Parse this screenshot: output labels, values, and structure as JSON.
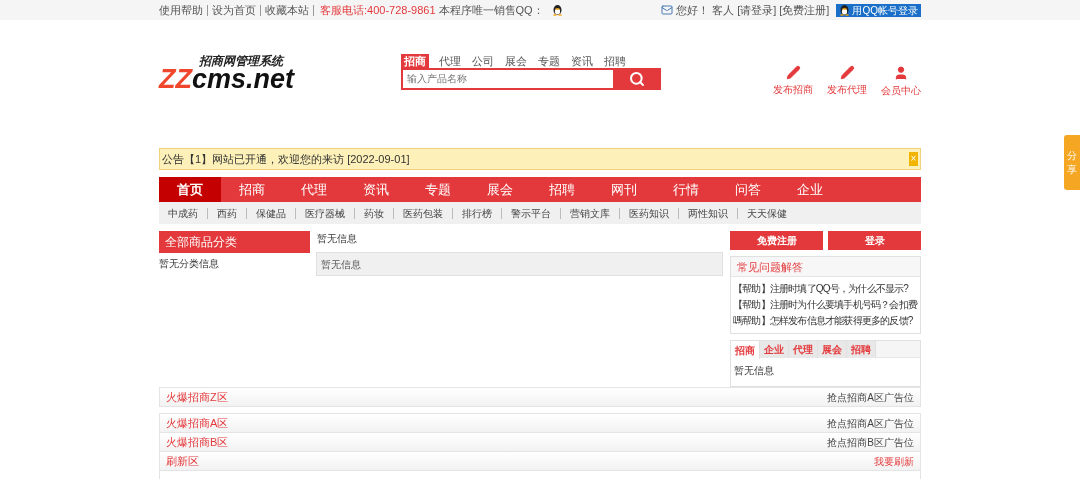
{
  "top_bar": {
    "links": [
      "使用帮助",
      "设为首页",
      "收藏本站"
    ],
    "hotline": "客服电话:400-728-9861",
    "qq_label": "本程序唯一销售QQ：",
    "greeting": "您好！",
    "user": "客人",
    "login": "[请登录]",
    "register": "[免费注册]",
    "qq_login": "用QQ帐号登录"
  },
  "header": {
    "logo_subtitle": "招商网管理系统",
    "logo_accent": "ZZ",
    "logo_rest": "cms.net",
    "search_tabs": [
      {
        "label": "招商",
        "selected": true
      },
      {
        "label": "代理",
        "selected": false
      },
      {
        "label": "公司",
        "selected": false
      },
      {
        "label": "展会",
        "selected": false
      },
      {
        "label": "专题",
        "selected": false
      },
      {
        "label": "资讯",
        "selected": false
      },
      {
        "label": "招聘",
        "selected": false
      }
    ],
    "search_placeholder": "输入产品名称",
    "actions": [
      {
        "label": "发布招商",
        "kind": "pencil"
      },
      {
        "label": "发布代理",
        "kind": "pencil"
      },
      {
        "label": "会员中心",
        "kind": "user"
      }
    ]
  },
  "notice": {
    "text": "公告【1】网站已开通，欢迎您的来访 [2022-09-01]",
    "close": "×"
  },
  "nav": [
    {
      "label": "首页",
      "selected": true
    },
    {
      "label": "招商",
      "selected": false
    },
    {
      "label": "代理",
      "selected": false
    },
    {
      "label": "资讯",
      "selected": false
    },
    {
      "label": "专题",
      "selected": false
    },
    {
      "label": "展会",
      "selected": false
    },
    {
      "label": "招聘",
      "selected": false
    },
    {
      "label": "网刊",
      "selected": false
    },
    {
      "label": "行情",
      "selected": false
    },
    {
      "label": "问答",
      "selected": false
    },
    {
      "label": "企业",
      "selected": false
    }
  ],
  "subnav": [
    "中成药",
    "西药",
    "保健品",
    "医疗器械",
    "药妆",
    "医药包装",
    "排行榜",
    "警示平台",
    "营销文库",
    "医药知识",
    "两性知识",
    "天天保健"
  ],
  "categories": {
    "title": "全部商品分类",
    "empty": "暂无分类信息"
  },
  "middle": {
    "heading": "暂无信息",
    "box_text": "暂无信息"
  },
  "account_buttons": [
    "免费注册",
    "登录"
  ],
  "faq": {
    "title": "常见问题解答",
    "lines": [
      "【帮助】注册时填了QQ号，为什么不显示?",
      "【帮助】注册时为什么要填手机号码？会扣费",
      "嗎帮助】怎样发布信息才能获得更多的反馈?"
    ]
  },
  "info_tabs": {
    "tabs": [
      {
        "label": "招商",
        "selected": true
      },
      {
        "label": "企业",
        "selected": false
      },
      {
        "label": "代理",
        "selected": false
      },
      {
        "label": "展会",
        "selected": false
      },
      {
        "label": "招聘",
        "selected": false
      }
    ],
    "empty": "暂无信息"
  },
  "sections": [
    {
      "rows": [
        {
          "title": "火爆招商Z区",
          "link": "抢点招商A区广告位",
          "kind": "ad"
        }
      ]
    },
    {
      "rows": [
        {
          "title": "火爆招商A区",
          "link": "抢点招商A区广告位",
          "kind": "ad"
        },
        {
          "title": "火爆招商B区",
          "link": "抢点招商B区广告位",
          "kind": "ad"
        },
        {
          "title": "刷新区",
          "link": "我要刷新",
          "kind": "refresh"
        }
      ]
    }
  ],
  "share_tab": "分享"
}
